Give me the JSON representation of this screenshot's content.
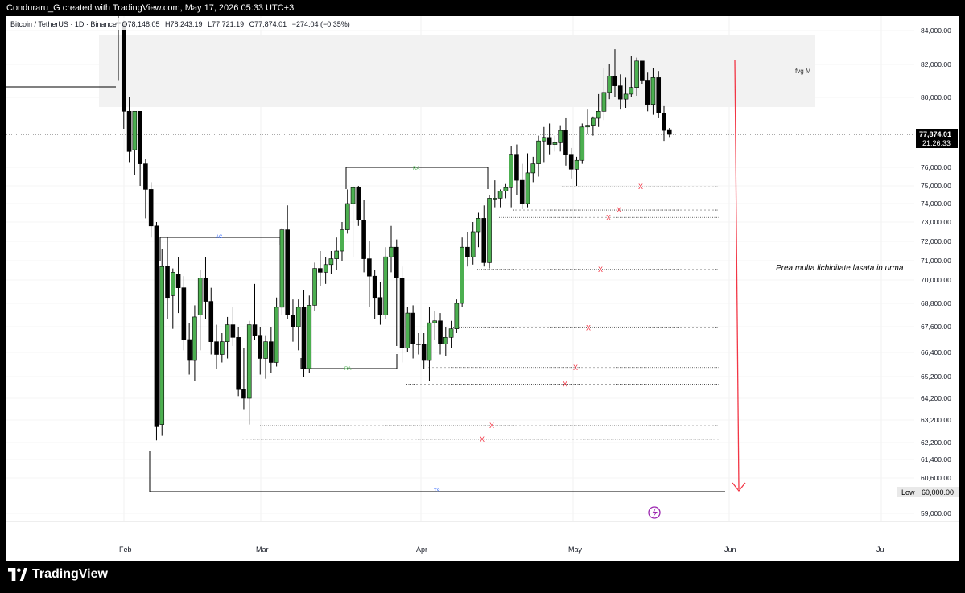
{
  "header": {
    "created_by": "Conduraru_G created with TradingView.com, May 17, 2026 05:33 UTC+3"
  },
  "symbol": {
    "name": "Bitcoin / TetherUS · 1D · Binance",
    "o_label": "O",
    "o": "78,148.05",
    "h_label": "H",
    "h": "78,243.19",
    "l_label": "L",
    "l": "77,721.19",
    "c_label": "C",
    "c": "77,874.01",
    "change": "−274.04 (−0.35%)"
  },
  "price_axis": {
    "ticks": [
      "84,000.00",
      "82,000.00",
      "80,000.00",
      "76,000.00",
      "75,000.00",
      "74,000.00",
      "73,000.00",
      "72,000.00",
      "71,000.00",
      "70,000.00",
      "68,800.00",
      "67,600.00",
      "66,400.00",
      "65,200.00",
      "64,200.00",
      "63,200.00",
      "62,200.00",
      "61,400.00",
      "60,600.00",
      "59,000.00"
    ],
    "current_price": "77,874.01",
    "countdown": "21:26:33",
    "low_label": "Low",
    "low_value": "60,000.00"
  },
  "time_axis": {
    "labels": [
      "Feb",
      "Mar",
      "Apr",
      "May",
      "Jun",
      "Jul"
    ]
  },
  "annotations": {
    "fvg": "fvg M",
    "ac": "AC",
    "ra_top": "RA",
    "ra_bottom": "RA",
    "ts": "TS",
    "note": "Prea multa lichiditate lasata in urma",
    "x_mark": "X"
  },
  "colors": {
    "up": "#4caf50",
    "down": "#000000",
    "marker": "#f23645",
    "arrow": "#f23645",
    "blue": "#2962ff",
    "green_label": "#4caf50"
  },
  "footer": {
    "brand": "TradingView"
  },
  "chart_data": {
    "type": "candlestick",
    "title": "Bitcoin / TetherUS · 1D · Binance",
    "ylim": [
      58500,
      85000
    ],
    "candles": [
      {
        "o": 84500,
        "h": 85000,
        "l": 81000,
        "c": 84400
      },
      {
        "o": 84400,
        "h": 84600,
        "l": 78200,
        "c": 79200
      },
      {
        "o": 79200,
        "h": 80000,
        "l": 76300,
        "c": 76900
      },
      {
        "o": 77000,
        "h": 79200,
        "l": 75600,
        "c": 79200
      },
      {
        "o": 79200,
        "h": 79200,
        "l": 75000,
        "c": 76200
      },
      {
        "o": 76200,
        "h": 76500,
        "l": 73200,
        "c": 74800
      },
      {
        "o": 74800,
        "h": 75200,
        "l": 72200,
        "c": 72800
      },
      {
        "o": 72800,
        "h": 73000,
        "l": 62300,
        "c": 62900
      },
      {
        "o": 63000,
        "h": 71600,
        "l": 62500,
        "c": 70700
      },
      {
        "o": 70700,
        "h": 72200,
        "l": 68000,
        "c": 69100
      },
      {
        "o": 69200,
        "h": 70600,
        "l": 67500,
        "c": 70400
      },
      {
        "o": 70300,
        "h": 71200,
        "l": 68300,
        "c": 69600
      },
      {
        "o": 69600,
        "h": 70200,
        "l": 66500,
        "c": 67000
      },
      {
        "o": 67000,
        "h": 67800,
        "l": 65300,
        "c": 66000
      },
      {
        "o": 66000,
        "h": 68700,
        "l": 65000,
        "c": 68100
      },
      {
        "o": 68200,
        "h": 70500,
        "l": 66500,
        "c": 70100
      },
      {
        "o": 70100,
        "h": 71200,
        "l": 68000,
        "c": 68900
      },
      {
        "o": 68900,
        "h": 69600,
        "l": 66300,
        "c": 66900
      },
      {
        "o": 66900,
        "h": 67700,
        "l": 65600,
        "c": 66300
      },
      {
        "o": 66300,
        "h": 67300,
        "l": 65900,
        "c": 66900
      },
      {
        "o": 66900,
        "h": 68100,
        "l": 66100,
        "c": 67700
      },
      {
        "o": 67700,
        "h": 68600,
        "l": 66700,
        "c": 67100
      },
      {
        "o": 67100,
        "h": 67600,
        "l": 64300,
        "c": 64600
      },
      {
        "o": 64600,
        "h": 66600,
        "l": 63700,
        "c": 64200
      },
      {
        "o": 64200,
        "h": 67900,
        "l": 63000,
        "c": 67700
      },
      {
        "o": 67700,
        "h": 69800,
        "l": 67000,
        "c": 67200
      },
      {
        "o": 67200,
        "h": 67600,
        "l": 65300,
        "c": 66100
      },
      {
        "o": 66100,
        "h": 67200,
        "l": 65100,
        "c": 66900
      },
      {
        "o": 66900,
        "h": 67600,
        "l": 65400,
        "c": 65900
      },
      {
        "o": 65900,
        "h": 69100,
        "l": 65700,
        "c": 68600
      },
      {
        "o": 68600,
        "h": 72700,
        "l": 68200,
        "c": 72600
      },
      {
        "o": 72600,
        "h": 73900,
        "l": 68000,
        "c": 68200
      },
      {
        "o": 68200,
        "h": 69000,
        "l": 66900,
        "c": 67600
      },
      {
        "o": 67600,
        "h": 69000,
        "l": 66500,
        "c": 68600
      },
      {
        "o": 68600,
        "h": 69500,
        "l": 65200,
        "c": 65600
      },
      {
        "o": 65600,
        "h": 69200,
        "l": 65400,
        "c": 68700
      },
      {
        "o": 68700,
        "h": 70900,
        "l": 68400,
        "c": 70600
      },
      {
        "o": 70600,
        "h": 71500,
        "l": 69700,
        "c": 70400
      },
      {
        "o": 70400,
        "h": 71200,
        "l": 69800,
        "c": 70800
      },
      {
        "o": 70800,
        "h": 71500,
        "l": 70300,
        "c": 71100
      },
      {
        "o": 71100,
        "h": 72200,
        "l": 70500,
        "c": 71500
      },
      {
        "o": 71500,
        "h": 73000,
        "l": 71000,
        "c": 72600
      },
      {
        "o": 72600,
        "h": 74800,
        "l": 72400,
        "c": 74000
      },
      {
        "o": 74000,
        "h": 75000,
        "l": 71200,
        "c": 74900
      },
      {
        "o": 74900,
        "h": 75000,
        "l": 72800,
        "c": 73100
      },
      {
        "o": 73100,
        "h": 74200,
        "l": 70400,
        "c": 71100
      },
      {
        "o": 71100,
        "h": 72000,
        "l": 68600,
        "c": 70200
      },
      {
        "o": 70200,
        "h": 70500,
        "l": 68000,
        "c": 69100
      },
      {
        "o": 69100,
        "h": 69900,
        "l": 67700,
        "c": 68200
      },
      {
        "o": 68200,
        "h": 71700,
        "l": 68000,
        "c": 71200
      },
      {
        "o": 71200,
        "h": 72800,
        "l": 70400,
        "c": 71700
      },
      {
        "o": 71700,
        "h": 72100,
        "l": 66700,
        "c": 70100
      },
      {
        "o": 70100,
        "h": 70700,
        "l": 65900,
        "c": 66600
      },
      {
        "o": 66600,
        "h": 68600,
        "l": 66400,
        "c": 68300
      },
      {
        "o": 68300,
        "h": 68700,
        "l": 66100,
        "c": 66800
      },
      {
        "o": 66800,
        "h": 67300,
        "l": 66300,
        "c": 66800
      },
      {
        "o": 66800,
        "h": 67300,
        "l": 65600,
        "c": 66000
      },
      {
        "o": 66000,
        "h": 68600,
        "l": 65000,
        "c": 67800
      },
      {
        "o": 67800,
        "h": 68400,
        "l": 67000,
        "c": 67900
      },
      {
        "o": 67900,
        "h": 68300,
        "l": 66300,
        "c": 66800
      },
      {
        "o": 66800,
        "h": 67600,
        "l": 66200,
        "c": 67100
      },
      {
        "o": 67100,
        "h": 67900,
        "l": 66600,
        "c": 67500
      },
      {
        "o": 67500,
        "h": 69000,
        "l": 67300,
        "c": 68800
      },
      {
        "o": 68800,
        "h": 72200,
        "l": 68600,
        "c": 71700
      },
      {
        "o": 71700,
        "h": 72500,
        "l": 70700,
        "c": 71200
      },
      {
        "o": 71200,
        "h": 73000,
        "l": 70800,
        "c": 72500
      },
      {
        "o": 72500,
        "h": 73500,
        "l": 71700,
        "c": 73200
      },
      {
        "o": 73200,
        "h": 73900,
        "l": 70700,
        "c": 70900
      },
      {
        "o": 70900,
        "h": 74500,
        "l": 70600,
        "c": 74300
      },
      {
        "o": 74300,
        "h": 75300,
        "l": 73800,
        "c": 74300
      },
      {
        "o": 74300,
        "h": 74800,
        "l": 73800,
        "c": 74700
      },
      {
        "o": 74700,
        "h": 75100,
        "l": 74300,
        "c": 74900
      },
      {
        "o": 74900,
        "h": 77200,
        "l": 73800,
        "c": 76700
      },
      {
        "o": 76700,
        "h": 77300,
        "l": 74500,
        "c": 75300
      },
      {
        "o": 75300,
        "h": 76200,
        "l": 73700,
        "c": 74000
      },
      {
        "o": 74000,
        "h": 76800,
        "l": 73800,
        "c": 75700
      },
      {
        "o": 75700,
        "h": 76600,
        "l": 75200,
        "c": 76200
      },
      {
        "o": 76200,
        "h": 77800,
        "l": 75500,
        "c": 77500
      },
      {
        "o": 77500,
        "h": 78300,
        "l": 76300,
        "c": 77700
      },
      {
        "o": 77700,
        "h": 78500,
        "l": 76700,
        "c": 77300
      },
      {
        "o": 77300,
        "h": 77800,
        "l": 76900,
        "c": 77400
      },
      {
        "o": 77400,
        "h": 78400,
        "l": 76900,
        "c": 78100
      },
      {
        "o": 78100,
        "h": 78800,
        "l": 76100,
        "c": 76700
      },
      {
        "o": 76700,
        "h": 77100,
        "l": 75400,
        "c": 75900
      },
      {
        "o": 75900,
        "h": 76600,
        "l": 75000,
        "c": 76400
      },
      {
        "o": 76400,
        "h": 78500,
        "l": 76200,
        "c": 78300
      },
      {
        "o": 78300,
        "h": 79300,
        "l": 77900,
        "c": 78400
      },
      {
        "o": 78400,
        "h": 78900,
        "l": 77800,
        "c": 78800
      },
      {
        "o": 78800,
        "h": 80200,
        "l": 78300,
        "c": 79200
      },
      {
        "o": 79200,
        "h": 81800,
        "l": 78700,
        "c": 80300
      },
      {
        "o": 80300,
        "h": 82000,
        "l": 79900,
        "c": 81300
      },
      {
        "o": 81300,
        "h": 82900,
        "l": 80000,
        "c": 80700
      },
      {
        "o": 80700,
        "h": 81400,
        "l": 79300,
        "c": 79900
      },
      {
        "o": 79900,
        "h": 81200,
        "l": 79400,
        "c": 80200
      },
      {
        "o": 80200,
        "h": 82500,
        "l": 80000,
        "c": 80600
      },
      {
        "o": 80600,
        "h": 82400,
        "l": 80100,
        "c": 82200
      },
      {
        "o": 82200,
        "h": 82200,
        "l": 80800,
        "c": 81000
      },
      {
        "o": 81000,
        "h": 81500,
        "l": 79200,
        "c": 79600
      },
      {
        "o": 79600,
        "h": 81800,
        "l": 79000,
        "c": 81200
      },
      {
        "o": 81200,
        "h": 81600,
        "l": 78800,
        "c": 79100
      },
      {
        "o": 79100,
        "h": 79500,
        "l": 77500,
        "c": 78100
      },
      {
        "o": 78148,
        "h": 78243,
        "l": 77721,
        "c": 77874
      }
    ]
  }
}
